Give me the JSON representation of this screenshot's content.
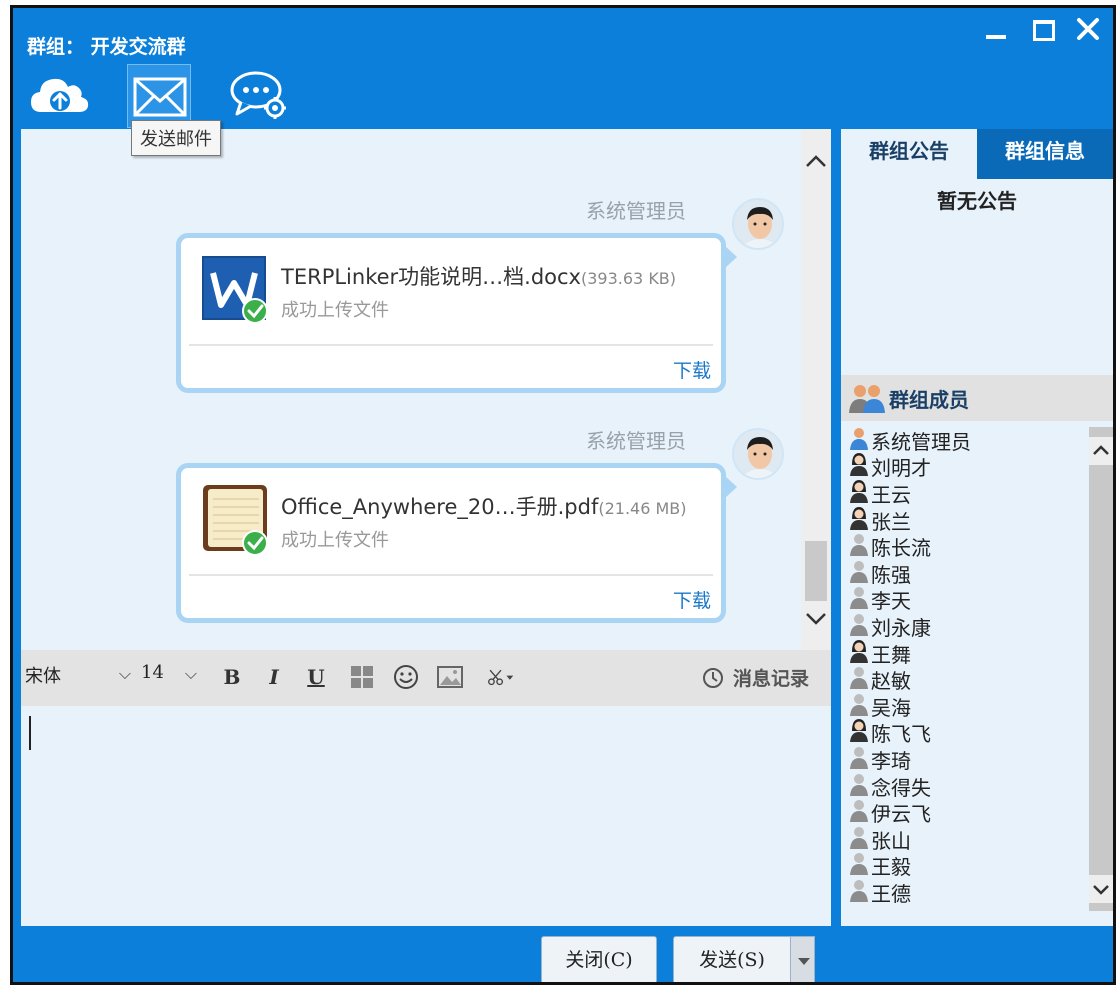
{
  "window": {
    "title": "群组： 开发交流群"
  },
  "toolbar": {
    "upload_icon": "cloud-upload-icon",
    "mail_icon": "envelope-icon",
    "settings_icon": "chat-settings-icon",
    "tooltip": "发送邮件"
  },
  "messages": [
    {
      "sender": "系统管理员",
      "file_name": "TERPLinker功能说明…档.docx",
      "file_size": "(393.63 KB)",
      "status": "成功上传文件",
      "download": "下载",
      "file_type": "word-doc-icon"
    },
    {
      "sender": "系统管理员",
      "file_name": "Office_Anywhere_20…手册.pdf",
      "file_size": "(21.46 MB)",
      "status": "成功上传文件",
      "download": "下载",
      "file_type": "notebook-doc-icon"
    }
  ],
  "format_bar": {
    "font": "宋体",
    "size": "14",
    "bold": "B",
    "italic": "I",
    "underline": "U",
    "history": "消息记录"
  },
  "side": {
    "tab_notice": "群组公告",
    "tab_info": "群组信息",
    "notice_text": "暂无公告",
    "members_title": "群组成员",
    "members": [
      {
        "name": "系统管理员",
        "type": "admin"
      },
      {
        "name": "刘明才",
        "type": "online"
      },
      {
        "name": "王云",
        "type": "online"
      },
      {
        "name": "张兰",
        "type": "online"
      },
      {
        "name": "陈长流",
        "type": "offline"
      },
      {
        "name": "陈强",
        "type": "offline"
      },
      {
        "name": "李天",
        "type": "offline"
      },
      {
        "name": "刘永康",
        "type": "offline"
      },
      {
        "name": "王舞",
        "type": "online"
      },
      {
        "name": "赵敏",
        "type": "offline"
      },
      {
        "name": "吴海",
        "type": "offline"
      },
      {
        "name": "陈飞飞",
        "type": "online"
      },
      {
        "name": "李琦",
        "type": "offline"
      },
      {
        "name": "念得失",
        "type": "offline"
      },
      {
        "name": "伊云飞",
        "type": "offline"
      },
      {
        "name": "张山",
        "type": "offline"
      },
      {
        "name": "王毅",
        "type": "offline"
      },
      {
        "name": "王德",
        "type": "offline"
      }
    ]
  },
  "buttons": {
    "close": "关闭(C)",
    "send": "发送(S)"
  },
  "colors": {
    "brand": "#0b7fd9",
    "bubble_border": "#a9d4f4",
    "link": "#1b78c8"
  }
}
